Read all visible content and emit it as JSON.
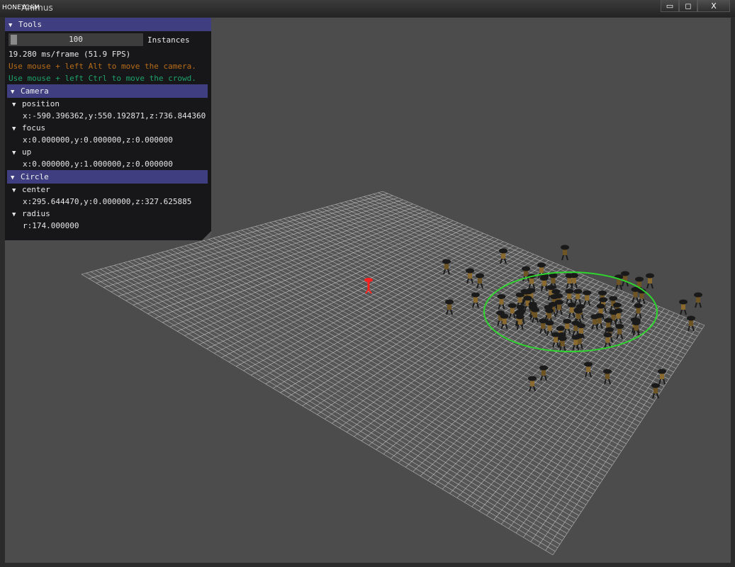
{
  "window": {
    "title": "Animus",
    "watermark": "HONEYCAM",
    "controls": {
      "minimize": "▭",
      "maximize": "◻",
      "close": "X"
    }
  },
  "tools": {
    "header": "Tools",
    "slider_value": "100",
    "slider_label": "Instances",
    "perf": "19.280 ms/frame (51.9 FPS)",
    "hint_camera": "Use mouse + left Alt to move the camera.",
    "hint_crowd": "Use mouse + left Ctrl to move the crowd."
  },
  "camera": {
    "header": "Camera",
    "position_label": "position",
    "position_value": "x:-590.396362,y:550.192871,z:736.844360",
    "focus_label": "focus",
    "focus_value": "x:0.000000,y:0.000000,z:0.000000",
    "up_label": "up",
    "up_value": "x:0.000000,y:1.000000,z:0.000000"
  },
  "circle": {
    "header": "Circle",
    "center_label": "center",
    "center_value": "x:295.644470,y:0.000000,z:327.625885",
    "radius_label": "radius",
    "radius_value": "r:174.000000"
  },
  "colors": {
    "viewport_bg": "#4c4c4c",
    "panel_header": "#3e3e80",
    "hint_camera": "#b96d18",
    "hint_crowd": "#1ea26a",
    "circle": "#2ed62e",
    "leader": "#ff1a1a"
  },
  "icons": {
    "app": "app-window-icon",
    "expand": "triangle-down-icon"
  }
}
